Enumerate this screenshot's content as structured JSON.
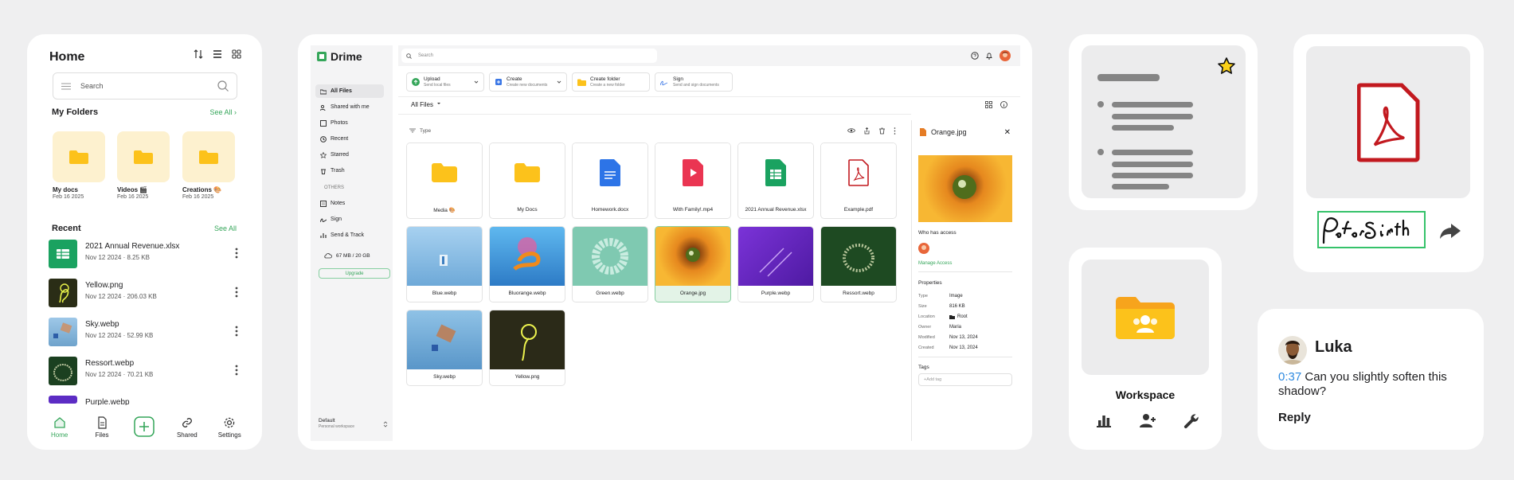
{
  "mobile": {
    "title": "Home",
    "search_placeholder": "Search",
    "my_folders": "My Folders",
    "see_all": "See All",
    "folders": [
      {
        "name": "My docs",
        "date": "Feb 16 2025"
      },
      {
        "name": "Videos 🎬",
        "date": "Feb 16 2025"
      },
      {
        "name": "Creations 🎨",
        "date": "Feb 16 2025"
      }
    ],
    "recent": "Recent",
    "recent_see_all": "See All",
    "files": [
      {
        "name": "2021 Annual Revenue.xlsx",
        "meta": "Nov 12 2024 · 8.25 KB"
      },
      {
        "name": "Yellow.png",
        "meta": "Nov 12 2024 · 206.03 KB"
      },
      {
        "name": "Sky.webp",
        "meta": "Nov 12 2024 · 52.99 KB"
      },
      {
        "name": "Ressort.webp",
        "meta": "Nov 12 2024 · 70.21 KB"
      },
      {
        "name": "Purple.webp",
        "meta": ""
      }
    ],
    "nav": [
      {
        "label": "Home"
      },
      {
        "label": "Files"
      },
      {
        "label": ""
      },
      {
        "label": "Shared"
      },
      {
        "label": "Settings"
      }
    ],
    "accent": "#35a65a"
  },
  "desktop": {
    "brand": "Drime",
    "search_placeholder": "Search",
    "sidebar": [
      {
        "label": "All Files"
      },
      {
        "label": "Shared with me"
      },
      {
        "label": "Photos"
      },
      {
        "label": "Recent"
      },
      {
        "label": "Starred"
      },
      {
        "label": "Trash"
      }
    ],
    "others_label": "OTHERS",
    "others": [
      {
        "label": "Notes"
      },
      {
        "label": "Sign"
      },
      {
        "label": "Send & Track"
      }
    ],
    "storage": "67 MB / 20 GB",
    "upgrade": "Upgrade",
    "workspace": "Default",
    "workspace_sub": "Personal workspace",
    "actions": [
      {
        "label": "Upload",
        "sub": "Send local files"
      },
      {
        "label": "Create",
        "sub": "Create new documents"
      },
      {
        "label": "Create folder",
        "sub": "Create a new folder"
      },
      {
        "label": "Sign",
        "sub": "Send and sign documents"
      }
    ],
    "all_files": "All Files",
    "type_filter": "Type",
    "tiles": [
      {
        "name": "Media 🎨"
      },
      {
        "name": "My Docs"
      },
      {
        "name": "Homework.docx"
      },
      {
        "name": "With Family!.mp4"
      },
      {
        "name": "2021 Annual Revenue.xlsx"
      },
      {
        "name": "Example.pdf"
      },
      {
        "name": "Blue.webp"
      },
      {
        "name": "Bluorange.webp"
      },
      {
        "name": "Green.webp"
      },
      {
        "name": "Orange.jpg"
      },
      {
        "name": "Purple.webp"
      },
      {
        "name": "Ressort.webp"
      },
      {
        "name": "Sky.webp"
      },
      {
        "name": "Yellow.png"
      }
    ],
    "panel": {
      "title": "Orange.jpg",
      "who_has_access": "Who has access",
      "manage_access": "Manage Access",
      "properties": "Properties",
      "props": [
        {
          "k": "Type",
          "v": "Image"
        },
        {
          "k": "Size",
          "v": "816 KB"
        },
        {
          "k": "Location",
          "v": "Root"
        },
        {
          "k": "Owner",
          "v": "Maria"
        },
        {
          "k": "Modified",
          "v": "Nov 13, 2024"
        },
        {
          "k": "Created",
          "v": "Nov 13, 2024"
        }
      ],
      "tags": "Tags",
      "add_tag": "+Add tag"
    }
  },
  "workspace_card": {
    "title": "Workspace"
  },
  "signature": {
    "name": "Peter Smith"
  },
  "comment": {
    "name": "Luka",
    "time": "0:37",
    "text": " Can you slightly soften this shadow?",
    "reply": "Reply"
  }
}
